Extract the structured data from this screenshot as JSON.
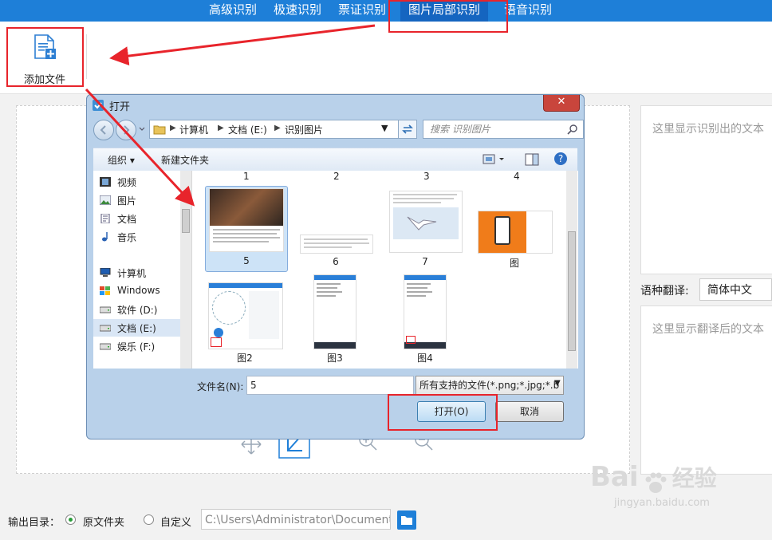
{
  "topnav": {
    "tabs": [
      {
        "label": "高级识别"
      },
      {
        "label": "极速识别"
      },
      {
        "label": "票证识别"
      },
      {
        "label": "图片局部识别"
      },
      {
        "label": "语音识别"
      }
    ]
  },
  "toolbar": {
    "add_file_label": "添加文件"
  },
  "right": {
    "result_placeholder": "这里显示识别出的文本",
    "translate_label": "语种翻译:",
    "translate_value": "简体中文",
    "translation_placeholder": "这里显示翻译后的文本"
  },
  "bottom": {
    "output_label": "输出目录：",
    "radio_source": "原文件夹",
    "radio_custom": "自定义",
    "path_value": "C:\\Users\\Administrator\\Documents"
  },
  "dialog": {
    "title": "打开",
    "close": "✕",
    "breadcrumb": [
      "计算机",
      "文档 (E:)",
      "识别图片"
    ],
    "search_placeholder": "搜索 识别图片",
    "cmd_organize": "组织 ▾",
    "cmd_newfolder": "新建文件夹",
    "nav_items": [
      "视频",
      "图片",
      "文档",
      "音乐",
      "计算机",
      "Windows",
      "软件 (D:)",
      "文档 (E:)",
      "娱乐 (F:)"
    ],
    "col_numbers": [
      "1",
      "2",
      "3",
      "4"
    ],
    "files": [
      {
        "name": "5"
      },
      {
        "name": "6"
      },
      {
        "name": "7"
      },
      {
        "name": "图"
      },
      {
        "name": "图2"
      },
      {
        "name": "图3"
      },
      {
        "name": "图4"
      }
    ],
    "filename_label": "文件名(N):",
    "filename_value": "5",
    "filetype_value": "所有支持的文件(*.png;*.jpg;*.b",
    "open_button": "打开(O)",
    "cancel_button": "取消"
  },
  "watermark": {
    "brand": "Bai",
    "brand2": "经验",
    "url": "jingyan.baidu.com"
  },
  "colors": {
    "nav": "#1e7fd8",
    "annotation": "#e8242b",
    "accent_green": "#2a9d3a"
  }
}
